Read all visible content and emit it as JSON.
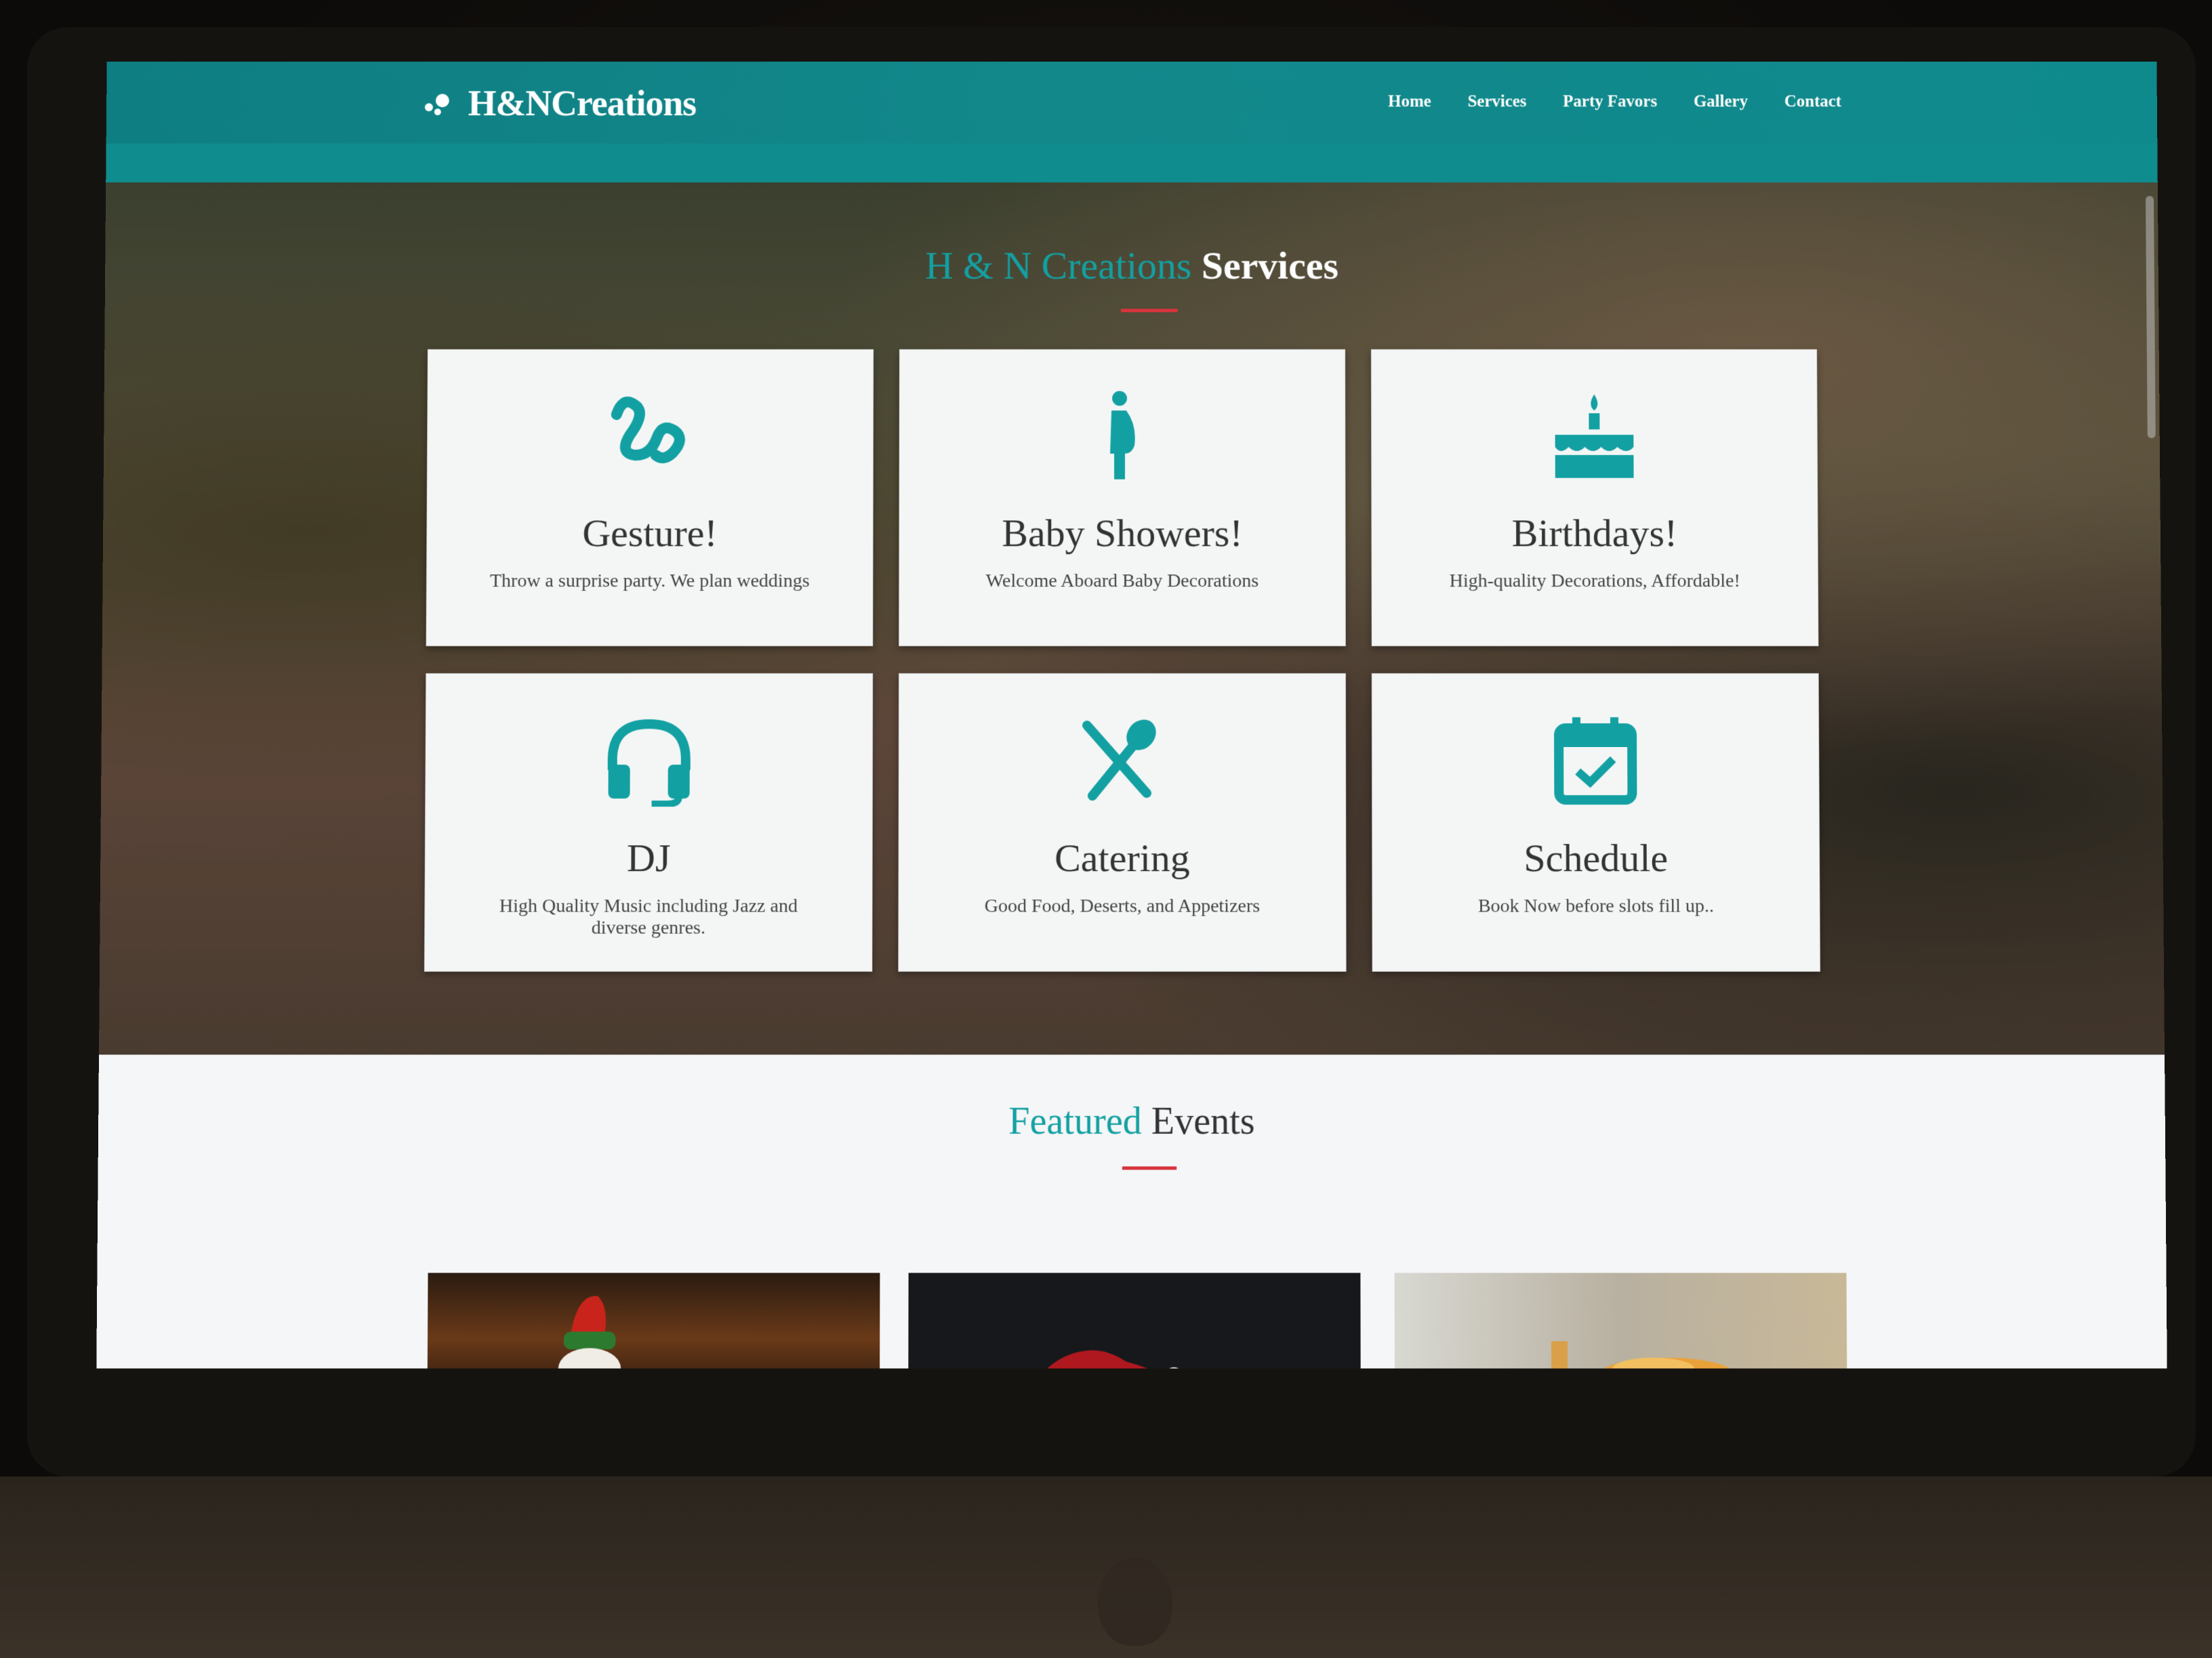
{
  "brand": {
    "name": "H&NCreations",
    "icon": "party-dots-icon"
  },
  "nav": {
    "items": [
      {
        "label": "Home"
      },
      {
        "label": "Services"
      },
      {
        "label": "Party Favors"
      },
      {
        "label": "Gallery"
      },
      {
        "label": "Contact"
      }
    ]
  },
  "hero": {
    "title_accent": "H & N Creations",
    "title_plain": "Services"
  },
  "services": [
    {
      "icon": "gesture-icon",
      "title": "Gesture!",
      "desc": "Throw a surprise party. We plan weddings"
    },
    {
      "icon": "pregnant-woman-icon",
      "title": "Baby Showers!",
      "desc": "Welcome Aboard Baby Decorations"
    },
    {
      "icon": "cake-icon",
      "title": "Birthdays!",
      "desc": "High-quality Decorations, Affordable!"
    },
    {
      "icon": "headset-icon",
      "title": "DJ",
      "desc": "High Quality Music including Jazz and diverse genres."
    },
    {
      "icon": "utensils-icon",
      "title": "Catering",
      "desc": "Good Food, Deserts, and Appetizers"
    },
    {
      "icon": "calendar-check-icon",
      "title": "Schedule",
      "desc": "Book Now before slots fill up.."
    }
  ],
  "featured": {
    "title_accent": "Featured",
    "title_plain": "Events"
  },
  "colors": {
    "teal": "#13a0a2",
    "navbar": "#0f8a8c",
    "underline_red": "#d9343c"
  }
}
